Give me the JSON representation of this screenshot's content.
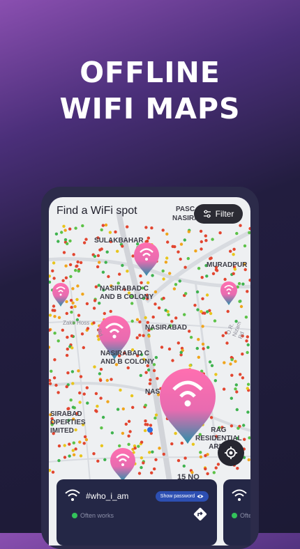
{
  "headline": {
    "line1": "OFFLINE",
    "line2": "WIFI MAPS"
  },
  "search": {
    "placeholder": "Find a WiFi spot"
  },
  "filter": {
    "label": "Filter",
    "icon": "sliders-icon"
  },
  "map_labels": {
    "sulakbahar": "SULAKBAHAR",
    "pasc": "PASC",
    "nasira_top": "NASIRA",
    "muradpur": "MURADPUR",
    "nasirabad_c1_l1": "NASIRABAD C",
    "nasirabad_c1_l2": "AND B COLONY",
    "nasirabad": "NASIRABAD",
    "nasirabad_c2_l1": "NASIRABAD C",
    "nasirabad_c2_l2": "AND B COLONY",
    "nas": "NAS",
    "sirabad_l1": "SIRABAD",
    "sirabad_l2": "OPERTIES",
    "sirabad_l3": "IMITED",
    "residential_l1": "RAG",
    "residential_l2": "RESIDENTIAL",
    "residential_l3": "AREA",
    "fifteen_no": "15 NO",
    "zakir_hoss": "Zakir Hoss",
    "road_nizam": "O.R. Nizam Rd",
    "road_rd": "Rd"
  },
  "card": {
    "ssid": "#who_i_am",
    "show_password": "Show password",
    "status": "Often works",
    "status_color": "#33c25a"
  },
  "card2": {
    "status": "Ofte"
  },
  "colors": {
    "accent_pin_top": "#ff6fb0",
    "accent_pin_bottom": "#2a8fa8",
    "card_bg": "#242746"
  }
}
